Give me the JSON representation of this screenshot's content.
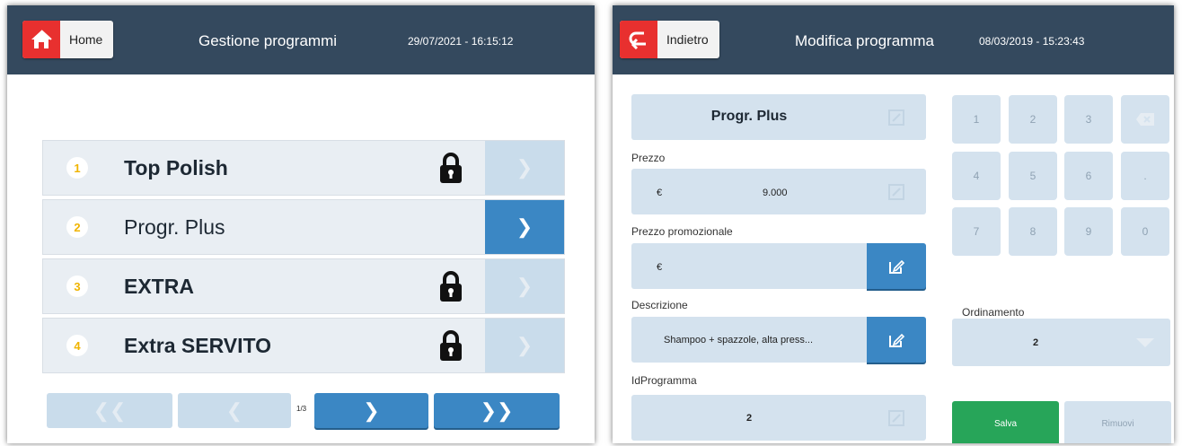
{
  "left": {
    "header": {
      "home_label": "Home",
      "title": "Gestione programmi",
      "datetime": "29/07/2021 - 16:15:12"
    },
    "programs": [
      {
        "num": "1",
        "name": "Top Polish",
        "locked": true
      },
      {
        "num": "2",
        "name": "Progr. Plus",
        "locked": false
      },
      {
        "num": "3",
        "name": "EXTRA",
        "locked": true
      },
      {
        "num": "4",
        "name": "Extra SERVITO",
        "locked": true
      }
    ],
    "pager": {
      "indicator": "1/3"
    }
  },
  "right": {
    "header": {
      "back_label": "Indietro",
      "title": "Modifica programma",
      "datetime": "08/03/2019 - 15:23:43"
    },
    "program_name": "Progr. Plus",
    "prezzo": {
      "label": "Prezzo",
      "currency": "€",
      "value": "9.000"
    },
    "prezzo_promo": {
      "label": "Prezzo promozionale",
      "currency": "€",
      "value": ""
    },
    "descrizione": {
      "label": "Descrizione",
      "value": "Shampoo + spazzole, alta press..."
    },
    "id_programma": {
      "label": "IdProgramma",
      "value": "2"
    },
    "ordinamento": {
      "label": "Ordinamento",
      "value": "2"
    },
    "keypad": [
      "1",
      "2",
      "3",
      "4",
      "5",
      "6",
      ".",
      "7",
      "8",
      "9",
      "0"
    ],
    "save_label": "Salva",
    "remove_label": "Rimuovi"
  },
  "colors": {
    "header": "#34495e",
    "accent_blue": "#3b87c4",
    "red": "#e8302f",
    "green": "#27a559",
    "field": "#d4e2ee"
  }
}
